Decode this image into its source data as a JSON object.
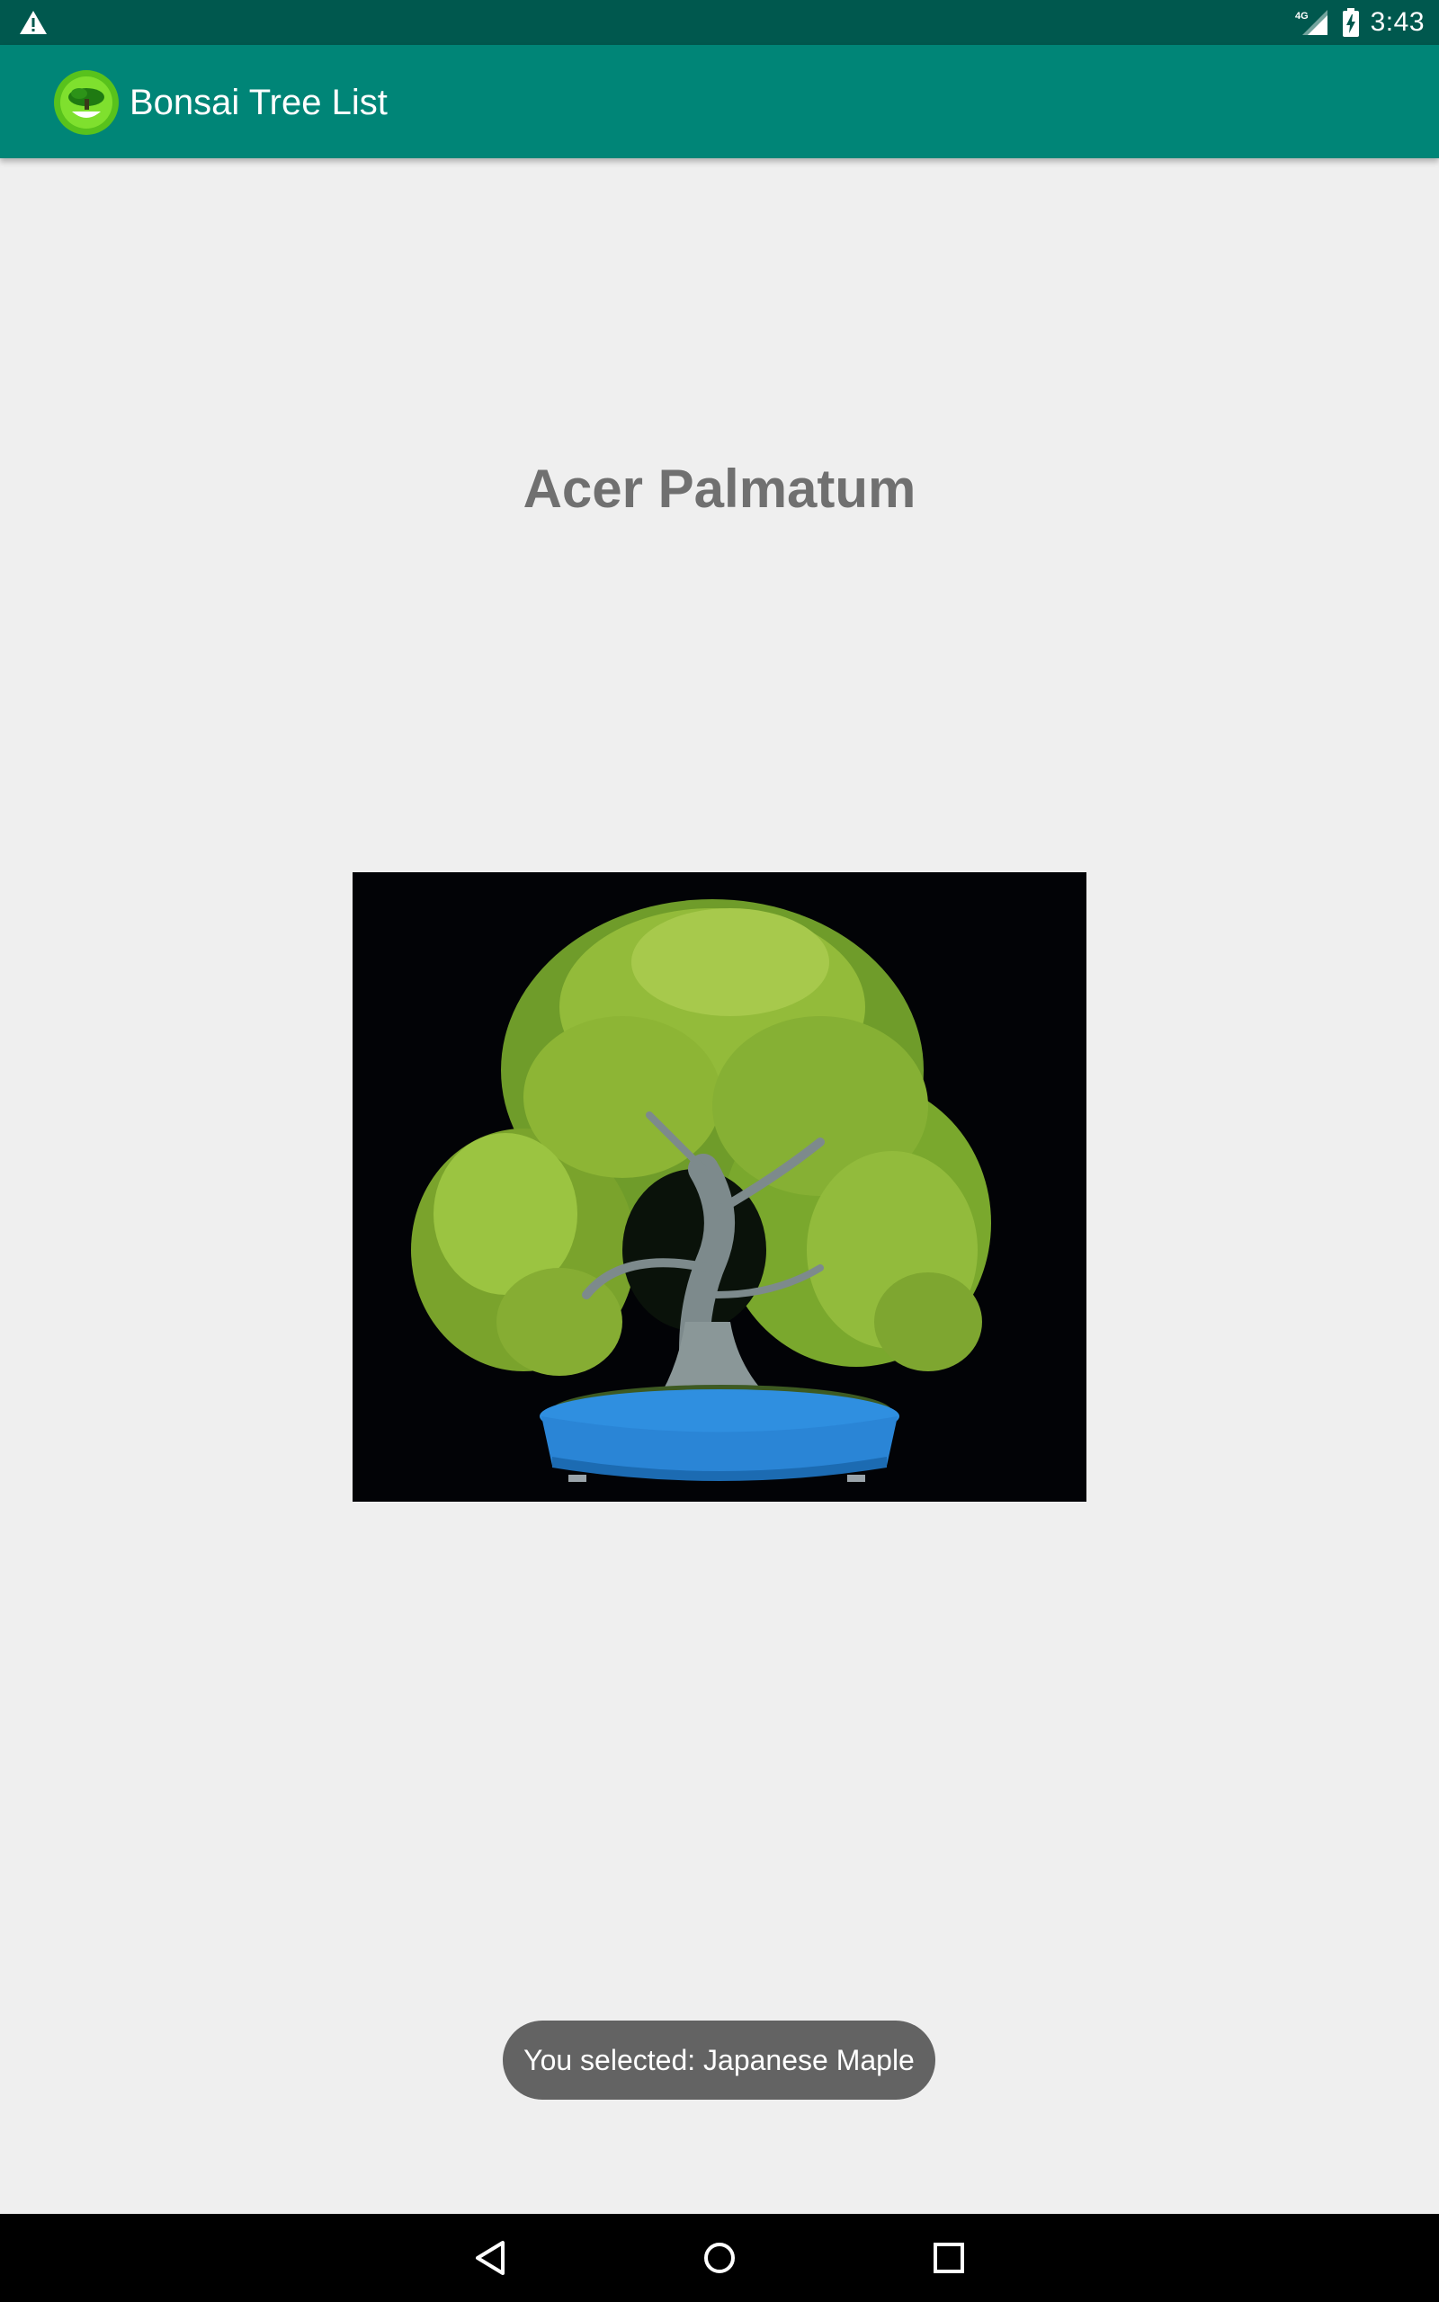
{
  "status_bar": {
    "network_label": "4G",
    "time": "3:43",
    "icons": [
      "warning-icon",
      "signal-icon",
      "battery-charging-icon"
    ]
  },
  "app_bar": {
    "title": "Bonsai Tree List",
    "logo_icon": "bonsai-logo-icon"
  },
  "detail": {
    "tree_name": "Acer Palmatum"
  },
  "toast": {
    "message": "You selected: Japanese Maple"
  },
  "nav_bar": {
    "icons": [
      "back-icon",
      "home-icon",
      "recents-icon"
    ]
  },
  "colors": {
    "status_bar": "#00584e",
    "app_bar": "#008577",
    "background": "#efefef",
    "title_text": "#707070",
    "toast_bg": "#636363",
    "nav_bar": "#000000",
    "pot_blue": "#2f8fe0"
  }
}
